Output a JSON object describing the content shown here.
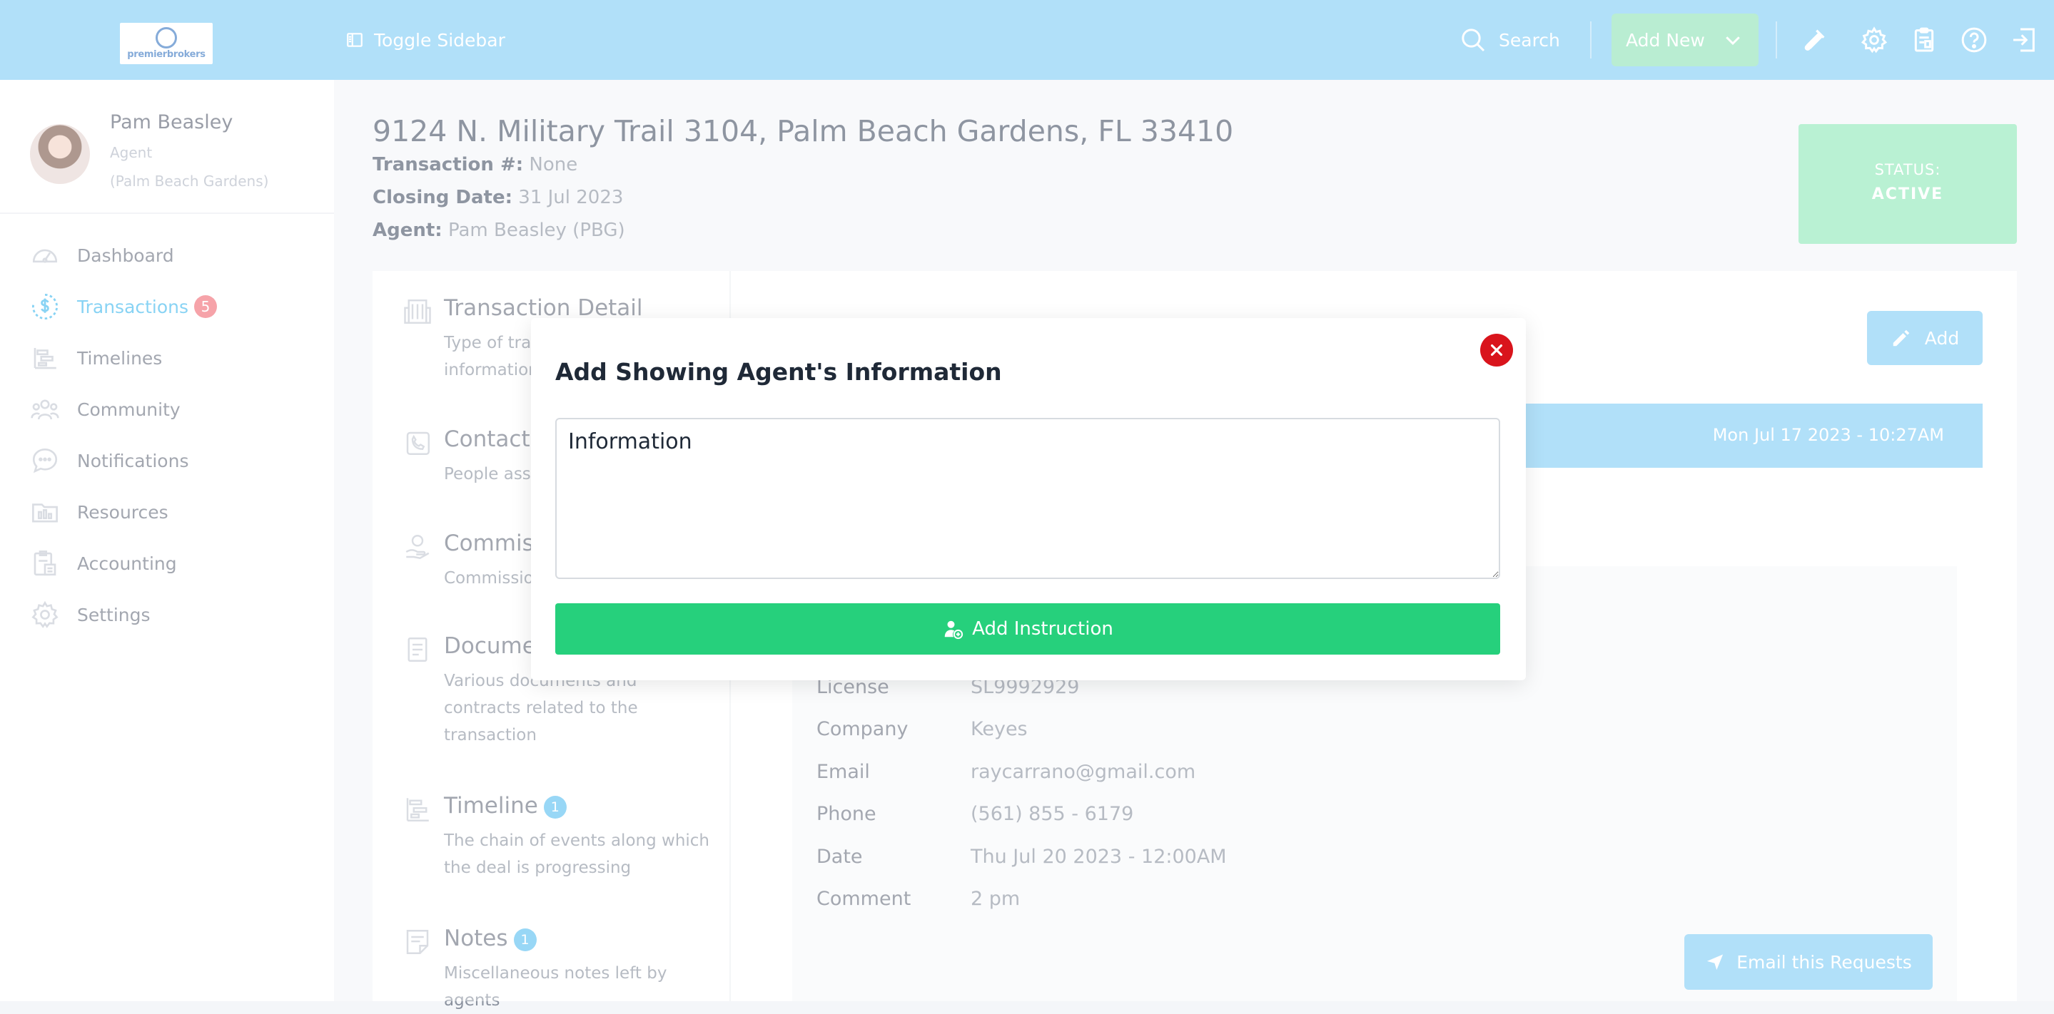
{
  "header": {
    "logo_text": "premierbrokers",
    "toggle_label": "Toggle Sidebar",
    "search_label": "Search",
    "add_new_label": "Add New"
  },
  "user": {
    "name": "Pam Beasley",
    "role": "Agent",
    "office": "(Palm Beach Gardens)"
  },
  "sidebar": {
    "items": [
      {
        "label": "Dashboard",
        "icon": "dashboard-icon"
      },
      {
        "label": "Transactions",
        "icon": "dollar-circle-icon",
        "badge": "5",
        "active": true
      },
      {
        "label": "Timelines",
        "icon": "timeline-icon"
      },
      {
        "label": "Community",
        "icon": "community-icon"
      },
      {
        "label": "Notifications",
        "icon": "chat-bubble-icon"
      },
      {
        "label": "Resources",
        "icon": "folder-icon"
      },
      {
        "label": "Accounting",
        "icon": "accounting-icon"
      },
      {
        "label": "Settings",
        "icon": "gear-icon"
      }
    ]
  },
  "transaction": {
    "address": "9124 N. Military Trail 3104, Palm Beach Gardens, FL 33410",
    "number_label": "Transaction #:",
    "number_value": "None",
    "closing_label": "Closing Date:",
    "closing_value": "31 Jul 2023",
    "agent_label": "Agent:",
    "agent_value": "Pam Beasley (PBG)",
    "status_label": "STATUS:",
    "status_value": "ACTIVE"
  },
  "sections": [
    {
      "title": "Transaction Detail",
      "desc": "Type of transaction, Property information",
      "icon": "building-icon"
    },
    {
      "title": "Contacts",
      "desc": "People associated",
      "icon": "contact-icon"
    },
    {
      "title": "Commission",
      "desc": "Commission details",
      "icon": "commission-icon"
    },
    {
      "title": "Documents",
      "desc": "Various documents and contracts related to the transaction",
      "icon": "document-icon"
    },
    {
      "title": "Timeline",
      "badge": "1",
      "desc": "The chain of events along which the deal is progressing",
      "icon": "timeline-icon"
    },
    {
      "title": "Notes",
      "badge": "1",
      "desc": "Miscellaneous notes left by agents",
      "icon": "notes-icon"
    }
  ],
  "request": {
    "add_label": "Add",
    "date": "Mon Jul 17 2023 - 10:27AM",
    "rows": [
      {
        "key": "License",
        "value": "SL9992929"
      },
      {
        "key": "Company",
        "value": "Keyes"
      },
      {
        "key": "Email",
        "value": "raycarrano@gmail.com"
      },
      {
        "key": "Phone",
        "value": "(561) 855 - 6179"
      },
      {
        "key": "Date",
        "value": "Thu Jul 20 2023 - 12:00AM"
      },
      {
        "key": "Comment",
        "value": "2 pm"
      }
    ],
    "email_button": "Email this Requests"
  },
  "modal": {
    "title": "Add Showing Agent's Information",
    "textarea_value": "Information",
    "submit_label": "Add Instruction"
  },
  "colors": {
    "topbar": "#82cdf5",
    "status": "#8ee8b9",
    "submit": "#26d07c",
    "close": "#d9141c",
    "badge_red": "#f06b75"
  }
}
